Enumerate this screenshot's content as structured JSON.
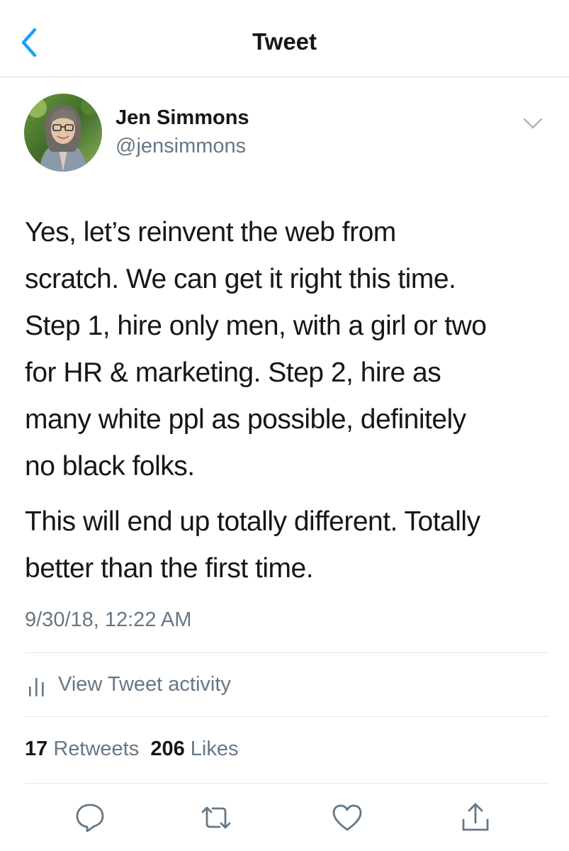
{
  "header": {
    "title": "Tweet",
    "back_icon": "chevron-left-icon"
  },
  "author": {
    "name": "Jen Simmons",
    "handle": "@jensimmons",
    "menu_icon": "chevron-down-icon"
  },
  "tweet": {
    "paragraph_1": "Yes, let’s reinvent the web from\nscratch. We can get it right this time.\nStep 1, hire only men, with a girl or two\nfor HR & marketing. Step 2, hire as\nmany white ppl as possible, definitely\nno black folks.",
    "paragraph_2": "This will end up totally different. Totally\nbetter than the first time.",
    "timestamp": "9/30/18, 12:22 AM"
  },
  "activity": {
    "label": "View Tweet activity",
    "icon": "bar-chart-icon"
  },
  "stats": {
    "retweets_count": "17",
    "retweets_label": "Retweets",
    "likes_count": "206",
    "likes_label": "Likes"
  },
  "actions": [
    "reply-icon",
    "retweet-icon",
    "like-icon",
    "share-icon"
  ],
  "colors": {
    "accent": "#1da1f2",
    "text": "#14171a",
    "secondary": "#657786",
    "divider": "#e1e8ed"
  }
}
